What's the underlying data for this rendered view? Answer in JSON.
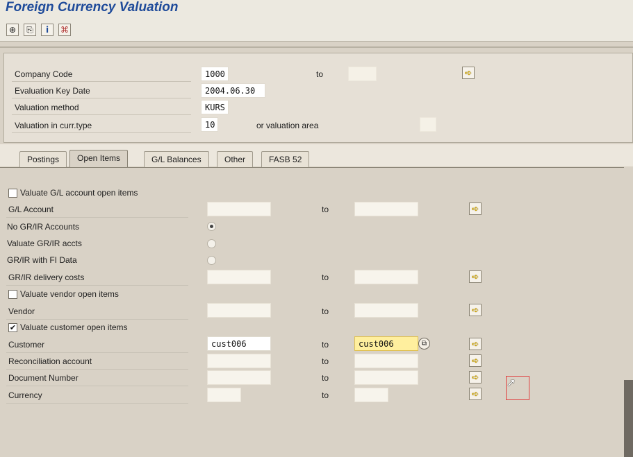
{
  "app": {
    "title": "Foreign Currency Valuation"
  },
  "toolbar": {
    "buttons": [
      {
        "icon": "execute-icon",
        "glyph": "⊕"
      },
      {
        "icon": "variant-icon",
        "glyph": "⎘"
      },
      {
        "icon": "info-icon",
        "glyph": "i"
      },
      {
        "icon": "selection-options-icon",
        "glyph": "⌘"
      }
    ]
  },
  "header": {
    "company_code_label": "Company Code",
    "company_code_value": "1000",
    "company_code_to_label": "to",
    "company_code_to_value": "",
    "eval_key_date_label": "Evaluation Key Date",
    "eval_key_date_value": "2004.06.30",
    "valuation_method_label": "Valuation method",
    "valuation_method_value": "KURS",
    "valuation_curr_type_label": "Valuation in curr.type",
    "valuation_curr_type_value": "10",
    "or_valuation_area_label": "or valuation area",
    "valuation_area_value": ""
  },
  "tabs": [
    {
      "label": "Postings",
      "selected": false
    },
    {
      "label": "Open Items",
      "selected": true
    },
    {
      "label": "G/L Balances",
      "selected": false
    },
    {
      "label": "Other",
      "selected": false
    },
    {
      "label": "FASB 52",
      "selected": false
    }
  ],
  "open_items": {
    "valuate_gl_label": "Valuate G/L account open items",
    "valuate_gl_checked": false,
    "gl_account_label": "G/L Account",
    "gl_account_from": "",
    "gl_account_to": "",
    "no_grir_label": "No GR/IR Accounts",
    "valuate_grir_label": "Valuate GR/IR accts",
    "grir_fi_label": "GR/IR with FI Data",
    "grir_selected": "No GR/IR Accounts",
    "grir_delivery_label": "GR/IR delivery costs",
    "grir_delivery_from": "",
    "grir_delivery_to": "",
    "valuate_vendor_label": "Valuate vendor open items",
    "valuate_vendor_checked": false,
    "vendor_label": "Vendor",
    "vendor_from": "",
    "vendor_to": "",
    "valuate_customer_label": "Valuate customer open items",
    "valuate_customer_checked": true,
    "customer_label": "Customer",
    "customer_from": "cust006",
    "customer_to": "cust006",
    "recon_label": "Reconciliation account",
    "recon_from": "",
    "recon_to": "",
    "docnum_label": "Document Number",
    "docnum_from": "",
    "docnum_to": "",
    "currency_label": "Currency",
    "currency_from": "",
    "currency_to": "",
    "to_label": "to"
  }
}
